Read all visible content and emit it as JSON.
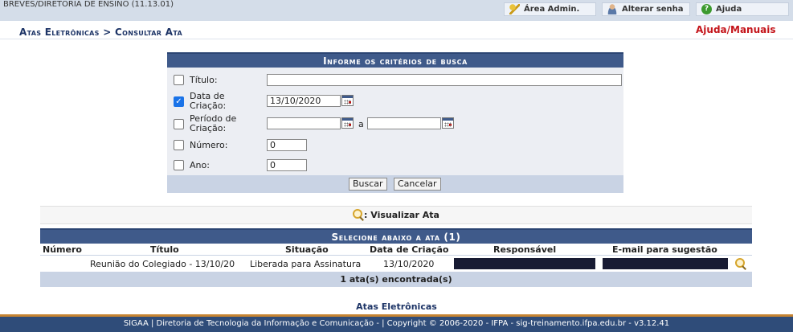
{
  "header": {
    "unit": "BREVES/DIRETORIA DE ENSINO (11.13.01)",
    "buttons": [
      {
        "label": "Área Admin.",
        "icon": "key-icon"
      },
      {
        "label": "Alterar senha",
        "icon": "user-icon"
      },
      {
        "label": "Ajuda",
        "icon": "help-icon"
      }
    ]
  },
  "breadcrumb": "Atas Eletrônicas > Consultar Ata",
  "help_manuals": "Ajuda/Manuais",
  "form": {
    "title": "Informe os critérios de busca",
    "titulo_label": "Título:",
    "titulo_value": "",
    "data_label_1": "Data de",
    "data_label_2": "Criação:",
    "data_checked": true,
    "data_value": "13/10/2020",
    "periodo_label_1": "Período de",
    "periodo_label_2": "Criação:",
    "periodo_sep": "a",
    "periodo_from": "",
    "periodo_to": "",
    "numero_label": "Número:",
    "numero_value": "0",
    "ano_label": "Ano:",
    "ano_value": "0",
    "buscar": "Buscar",
    "cancelar": "Cancelar"
  },
  "legend": {
    "label": ": Visualizar Ata",
    "icon": "magnifier-icon"
  },
  "results": {
    "title": "Selecione abaixo a ata (1)",
    "columns": [
      "Número",
      "Título",
      "Situação",
      "Data de Criação",
      "Responsável",
      "E-mail para sugestão"
    ],
    "rows": [
      {
        "numero": "",
        "titulo": "Reunião do Colegiado - 13/10/20",
        "situacao": "Liberada para Assinatura",
        "data": "13/10/2020"
      }
    ],
    "count": "1 ata(s) encontrada(s)"
  },
  "footer": {
    "link": "Atas Eletrônicas",
    "text": "SIGAA | Diretoria de Tecnologia da Informação e Comunicação - | Copyright © 2006-2020 - IFPA - sig-treinamento.ifpa.edu.br - v3.12.41"
  },
  "colors": {
    "accent": "#3f5a8a",
    "footer": "#2f4c79",
    "help_link": "#c4141a",
    "footer_border": "#c68432"
  }
}
